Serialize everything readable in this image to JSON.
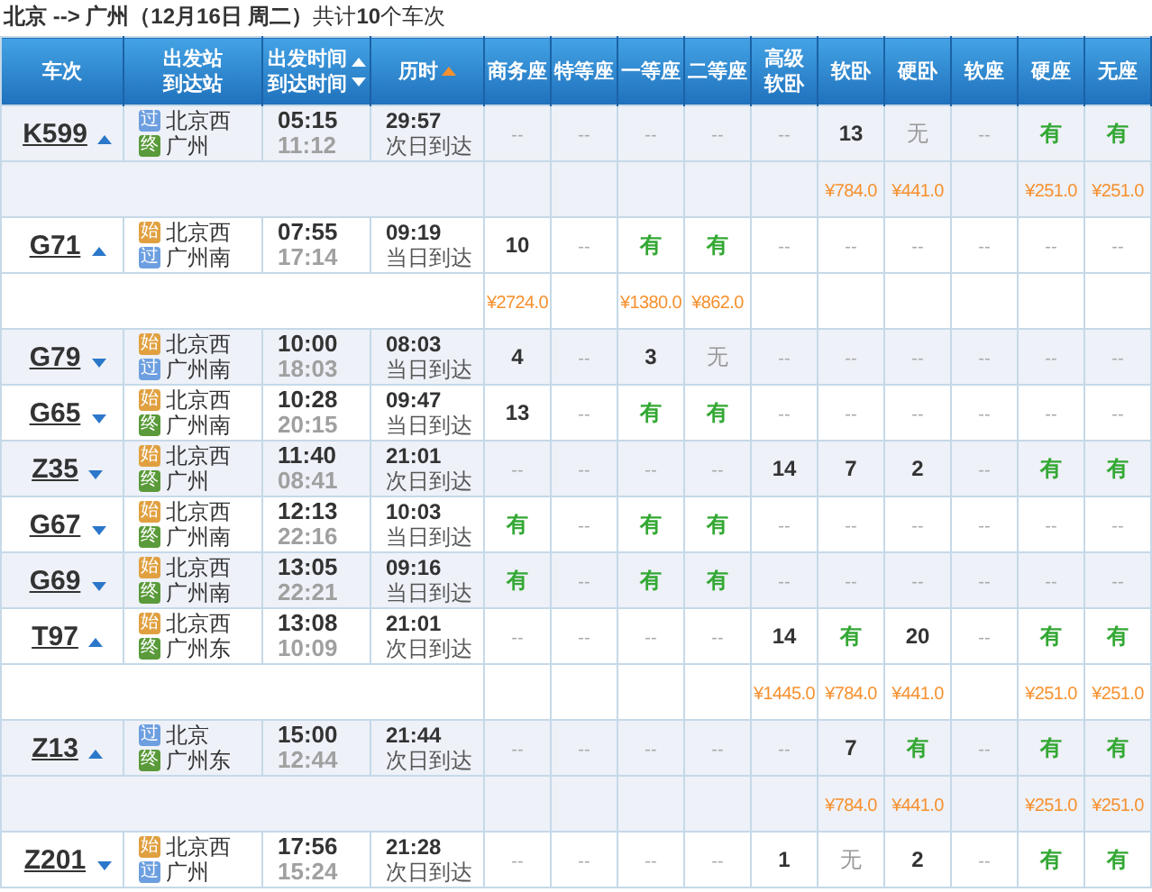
{
  "summary": "**北京 --> 广州（12月16日 周二）**共计**10**个车次",
  "columns": [
    {
      "lines": [
        {
          "text": "车次",
          "kind": "plain"
        }
      ]
    },
    {
      "lines": [
        {
          "text": "出发站",
          "kind": "plain"
        },
        {
          "text": "到达站",
          "kind": "plain"
        }
      ]
    },
    {
      "lines": [
        {
          "text": "出发时间",
          "kind": "ascending"
        },
        {
          "text": "到达时间",
          "kind": "descending"
        }
      ],
      "sorted": false
    },
    {
      "lines": [
        {
          "text": "历时",
          "kind": "ascending"
        }
      ],
      "sorted": true
    },
    {
      "lines": [
        {
          "text": "商务座",
          "kind": "plain"
        }
      ]
    },
    {
      "lines": [
        {
          "text": "特等座",
          "kind": "plain"
        }
      ]
    },
    {
      "lines": [
        {
          "text": "一等座",
          "kind": "plain"
        }
      ]
    },
    {
      "lines": [
        {
          "text": "二等座",
          "kind": "plain"
        }
      ]
    },
    {
      "lines": [
        {
          "text": "高级",
          "kind": "plain"
        },
        {
          "text": "软卧",
          "kind": "plain"
        }
      ]
    },
    {
      "lines": [
        {
          "text": "软卧",
          "kind": "plain"
        }
      ]
    },
    {
      "lines": [
        {
          "text": "硬卧",
          "kind": "plain"
        }
      ]
    },
    {
      "lines": [
        {
          "text": "软座",
          "kind": "plain"
        }
      ]
    },
    {
      "lines": [
        {
          "text": "硬座",
          "kind": "plain"
        }
      ]
    },
    {
      "lines": [
        {
          "text": "无座",
          "kind": "plain"
        }
      ]
    }
  ],
  "trains": [
    {
      "number": "K599",
      "expanded": true,
      "from": {
        "badge": "过",
        "kind": "pass",
        "name": "北京西"
      },
      "to": {
        "badge": "终",
        "kind": "end",
        "name": "广州"
      },
      "depart": "05:15",
      "arrive": "11:12",
      "duration": "29:57",
      "arrival_day": "次日到达",
      "seats": [
        {
          "text": "--",
          "kind": "dash"
        },
        {
          "text": "--",
          "kind": "dash"
        },
        {
          "text": "--",
          "kind": "dash"
        },
        {
          "text": "--",
          "kind": "dash"
        },
        {
          "text": "--",
          "kind": "dash"
        },
        {
          "text": "13",
          "kind": "count",
          "price": "¥784.0"
        },
        {
          "text": "无",
          "kind": "no",
          "price": "¥441.0"
        },
        {
          "text": "--",
          "kind": "dash"
        },
        {
          "text": "有",
          "kind": "yes",
          "price": "¥251.0"
        },
        {
          "text": "有",
          "kind": "yes",
          "price": "¥251.0"
        }
      ]
    },
    {
      "number": "G71",
      "expanded": true,
      "from": {
        "badge": "始",
        "kind": "start",
        "name": "北京西"
      },
      "to": {
        "badge": "过",
        "kind": "pass",
        "name": "广州南"
      },
      "depart": "07:55",
      "arrive": "17:14",
      "duration": "09:19",
      "arrival_day": "当日到达",
      "seats": [
        {
          "text": "10",
          "kind": "count",
          "price": "¥2724.0"
        },
        {
          "text": "--",
          "kind": "dash"
        },
        {
          "text": "有",
          "kind": "yes",
          "price": "¥1380.0"
        },
        {
          "text": "有",
          "kind": "yes",
          "price": "¥862.0"
        },
        {
          "text": "--",
          "kind": "dash"
        },
        {
          "text": "--",
          "kind": "dash"
        },
        {
          "text": "--",
          "kind": "dash"
        },
        {
          "text": "--",
          "kind": "dash"
        },
        {
          "text": "--",
          "kind": "dash"
        },
        {
          "text": "--",
          "kind": "dash"
        }
      ]
    },
    {
      "number": "G79",
      "expanded": false,
      "from": {
        "badge": "始",
        "kind": "start",
        "name": "北京西"
      },
      "to": {
        "badge": "过",
        "kind": "pass",
        "name": "广州南"
      },
      "depart": "10:00",
      "arrive": "18:03",
      "duration": "08:03",
      "arrival_day": "当日到达",
      "seats": [
        {
          "text": "4",
          "kind": "count"
        },
        {
          "text": "--",
          "kind": "dash"
        },
        {
          "text": "3",
          "kind": "count"
        },
        {
          "text": "无",
          "kind": "no"
        },
        {
          "text": "--",
          "kind": "dash"
        },
        {
          "text": "--",
          "kind": "dash"
        },
        {
          "text": "--",
          "kind": "dash"
        },
        {
          "text": "--",
          "kind": "dash"
        },
        {
          "text": "--",
          "kind": "dash"
        },
        {
          "text": "--",
          "kind": "dash"
        }
      ]
    },
    {
      "number": "G65",
      "expanded": false,
      "from": {
        "badge": "始",
        "kind": "start",
        "name": "北京西"
      },
      "to": {
        "badge": "终",
        "kind": "end",
        "name": "广州南"
      },
      "depart": "10:28",
      "arrive": "20:15",
      "duration": "09:47",
      "arrival_day": "当日到达",
      "seats": [
        {
          "text": "13",
          "kind": "count"
        },
        {
          "text": "--",
          "kind": "dash"
        },
        {
          "text": "有",
          "kind": "yes"
        },
        {
          "text": "有",
          "kind": "yes"
        },
        {
          "text": "--",
          "kind": "dash"
        },
        {
          "text": "--",
          "kind": "dash"
        },
        {
          "text": "--",
          "kind": "dash"
        },
        {
          "text": "--",
          "kind": "dash"
        },
        {
          "text": "--",
          "kind": "dash"
        },
        {
          "text": "--",
          "kind": "dash"
        }
      ]
    },
    {
      "number": "Z35",
      "expanded": false,
      "from": {
        "badge": "始",
        "kind": "start",
        "name": "北京西"
      },
      "to": {
        "badge": "终",
        "kind": "end",
        "name": "广州"
      },
      "depart": "11:40",
      "arrive": "08:41",
      "duration": "21:01",
      "arrival_day": "次日到达",
      "seats": [
        {
          "text": "--",
          "kind": "dash"
        },
        {
          "text": "--",
          "kind": "dash"
        },
        {
          "text": "--",
          "kind": "dash"
        },
        {
          "text": "--",
          "kind": "dash"
        },
        {
          "text": "14",
          "kind": "count"
        },
        {
          "text": "7",
          "kind": "count"
        },
        {
          "text": "2",
          "kind": "count"
        },
        {
          "text": "--",
          "kind": "dash"
        },
        {
          "text": "有",
          "kind": "yes"
        },
        {
          "text": "有",
          "kind": "yes"
        }
      ]
    },
    {
      "number": "G67",
      "expanded": false,
      "from": {
        "badge": "始",
        "kind": "start",
        "name": "北京西"
      },
      "to": {
        "badge": "终",
        "kind": "end",
        "name": "广州南"
      },
      "depart": "12:13",
      "arrive": "22:16",
      "duration": "10:03",
      "arrival_day": "当日到达",
      "seats": [
        {
          "text": "有",
          "kind": "yes"
        },
        {
          "text": "--",
          "kind": "dash"
        },
        {
          "text": "有",
          "kind": "yes"
        },
        {
          "text": "有",
          "kind": "yes"
        },
        {
          "text": "--",
          "kind": "dash"
        },
        {
          "text": "--",
          "kind": "dash"
        },
        {
          "text": "--",
          "kind": "dash"
        },
        {
          "text": "--",
          "kind": "dash"
        },
        {
          "text": "--",
          "kind": "dash"
        },
        {
          "text": "--",
          "kind": "dash"
        }
      ]
    },
    {
      "number": "G69",
      "expanded": false,
      "from": {
        "badge": "始",
        "kind": "start",
        "name": "北京西"
      },
      "to": {
        "badge": "终",
        "kind": "end",
        "name": "广州南"
      },
      "depart": "13:05",
      "arrive": "22:21",
      "duration": "09:16",
      "arrival_day": "当日到达",
      "seats": [
        {
          "text": "有",
          "kind": "yes"
        },
        {
          "text": "--",
          "kind": "dash"
        },
        {
          "text": "有",
          "kind": "yes"
        },
        {
          "text": "有",
          "kind": "yes"
        },
        {
          "text": "--",
          "kind": "dash"
        },
        {
          "text": "--",
          "kind": "dash"
        },
        {
          "text": "--",
          "kind": "dash"
        },
        {
          "text": "--",
          "kind": "dash"
        },
        {
          "text": "--",
          "kind": "dash"
        },
        {
          "text": "--",
          "kind": "dash"
        }
      ]
    },
    {
      "number": "T97",
      "expanded": true,
      "from": {
        "badge": "始",
        "kind": "start",
        "name": "北京西"
      },
      "to": {
        "badge": "终",
        "kind": "end",
        "name": "广州东"
      },
      "depart": "13:08",
      "arrive": "10:09",
      "duration": "21:01",
      "arrival_day": "次日到达",
      "seats": [
        {
          "text": "--",
          "kind": "dash"
        },
        {
          "text": "--",
          "kind": "dash"
        },
        {
          "text": "--",
          "kind": "dash"
        },
        {
          "text": "--",
          "kind": "dash"
        },
        {
          "text": "14",
          "kind": "count",
          "price": "¥1445.0"
        },
        {
          "text": "有",
          "kind": "yes",
          "price": "¥784.0"
        },
        {
          "text": "20",
          "kind": "count",
          "price": "¥441.0"
        },
        {
          "text": "--",
          "kind": "dash"
        },
        {
          "text": "有",
          "kind": "yes",
          "price": "¥251.0"
        },
        {
          "text": "有",
          "kind": "yes",
          "price": "¥251.0"
        }
      ]
    },
    {
      "number": "Z13",
      "expanded": true,
      "from": {
        "badge": "过",
        "kind": "pass",
        "name": "北京"
      },
      "to": {
        "badge": "终",
        "kind": "end",
        "name": "广州东"
      },
      "depart": "15:00",
      "arrive": "12:44",
      "duration": "21:44",
      "arrival_day": "次日到达",
      "seats": [
        {
          "text": "--",
          "kind": "dash"
        },
        {
          "text": "--",
          "kind": "dash"
        },
        {
          "text": "--",
          "kind": "dash"
        },
        {
          "text": "--",
          "kind": "dash"
        },
        {
          "text": "--",
          "kind": "dash"
        },
        {
          "text": "7",
          "kind": "count",
          "price": "¥784.0"
        },
        {
          "text": "有",
          "kind": "yes",
          "price": "¥441.0"
        },
        {
          "text": "--",
          "kind": "dash"
        },
        {
          "text": "有",
          "kind": "yes",
          "price": "¥251.0"
        },
        {
          "text": "有",
          "kind": "yes",
          "price": "¥251.0"
        }
      ]
    },
    {
      "number": "Z201",
      "expanded": false,
      "from": {
        "badge": "始",
        "kind": "start",
        "name": "北京西"
      },
      "to": {
        "badge": "过",
        "kind": "pass",
        "name": "广州"
      },
      "depart": "17:56",
      "arrive": "15:24",
      "duration": "21:28",
      "arrival_day": "次日到达",
      "seats": [
        {
          "text": "--",
          "kind": "dash"
        },
        {
          "text": "--",
          "kind": "dash"
        },
        {
          "text": "--",
          "kind": "dash"
        },
        {
          "text": "--",
          "kind": "dash"
        },
        {
          "text": "1",
          "kind": "count"
        },
        {
          "text": "无",
          "kind": "no"
        },
        {
          "text": "2",
          "kind": "count"
        },
        {
          "text": "--",
          "kind": "dash"
        },
        {
          "text": "有",
          "kind": "yes"
        },
        {
          "text": "有",
          "kind": "yes"
        }
      ]
    }
  ]
}
